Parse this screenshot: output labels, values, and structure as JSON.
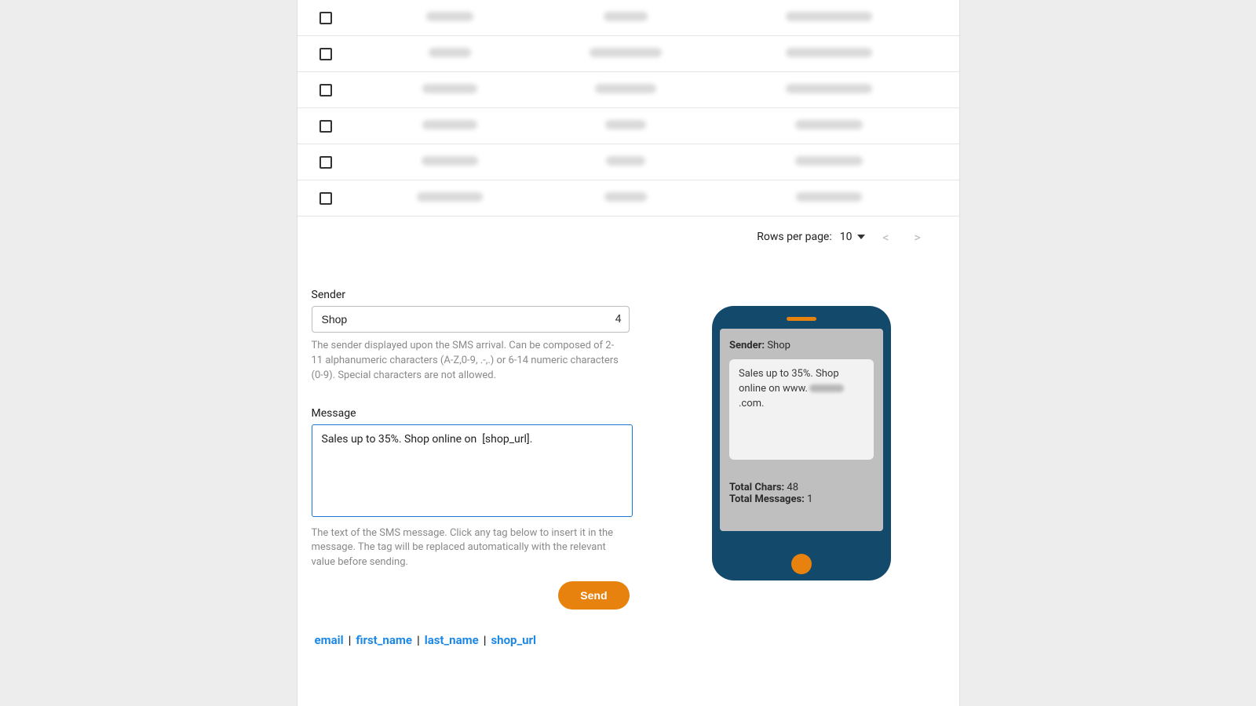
{
  "table": {
    "rows": [
      {
        "c1_w": 60,
        "c2_w": 56,
        "c3_w": 110
      },
      {
        "c1_w": 54,
        "c2_w": 92,
        "c3_w": 110
      },
      {
        "c1_w": 70,
        "c2_w": 78,
        "c3_w": 110
      },
      {
        "c1_w": 70,
        "c2_w": 52,
        "c3_w": 86
      },
      {
        "c1_w": 72,
        "c2_w": 50,
        "c3_w": 86
      },
      {
        "c1_w": 84,
        "c2_w": 54,
        "c3_w": 84
      }
    ]
  },
  "pagination": {
    "label": "Rows per page:",
    "value": "10"
  },
  "form": {
    "sender_label": "Sender",
    "sender_value": "Shop",
    "sender_count": "4",
    "sender_help": "The sender displayed upon the SMS arrival. Can be composed of 2-11 alphanumeric characters (A-Z,0-9, .-,.) or 6-14 numeric characters (0-9). Special characters are not allowed.",
    "message_label": "Message",
    "message_value": "Sales up to 35%. Shop online on  [shop_url].",
    "message_help": "The text of the SMS message. Click any tag below to insert it in the message. The tag will be replaced automatically with the relevant value before sending.",
    "send_label": "Send"
  },
  "tags": {
    "items": [
      "email",
      "first_name",
      "last_name",
      "shop_url"
    ]
  },
  "phone": {
    "sender_label": "Sender:",
    "sender_value": "Shop",
    "bubble_text_prefix": "Sales up to 35%. Shop online on www.",
    "bubble_text_suffix": ".com.",
    "total_chars_label": "Total Chars:",
    "total_chars_value": "48",
    "total_messages_label": "Total Messages:",
    "total_messages_value": "1"
  }
}
